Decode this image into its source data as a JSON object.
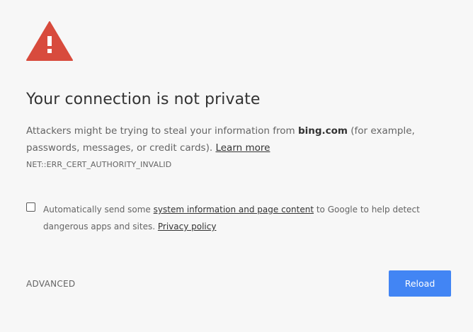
{
  "icon": {
    "name": "warning-icon",
    "color": "#d84b3d"
  },
  "heading": "Your connection is not private",
  "explanation": {
    "before": "Attackers might be trying to steal your information from ",
    "domain": "bing.com",
    "after": " (for example, passwords, messages, or credit cards). ",
    "learn_more": "Learn more"
  },
  "error_code": "NET::ERR_CERT_AUTHORITY_INVALID",
  "opt_in": {
    "checked": false,
    "before": "Automatically send some ",
    "link": "system information and page content",
    "after": " to Google to help detect dangerous apps and sites. ",
    "privacy_link": "Privacy policy"
  },
  "buttons": {
    "advanced": "ADVANCED",
    "reload": "Reload"
  },
  "colors": {
    "background": "#f7f7f7",
    "primary_button": "#4285f4"
  }
}
